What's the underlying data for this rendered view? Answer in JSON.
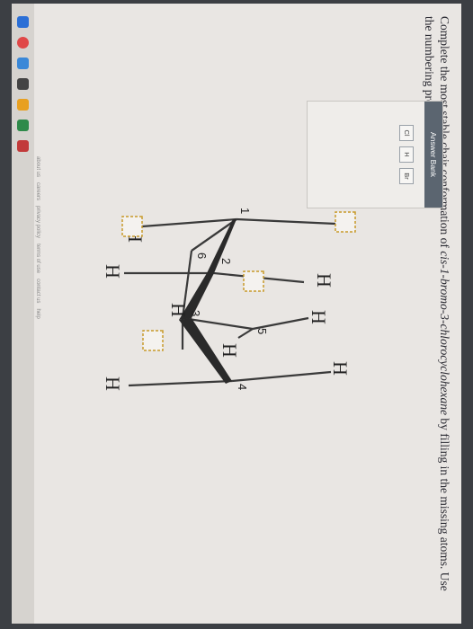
{
  "prompt": {
    "part1": "Complete the most stable chair conformation of ",
    "compound": "cis-1-bromo-3-chlorocyclohexane",
    "part2": " by filling in the missing atoms. Use the numbering provided on the ring."
  },
  "answer_bank": {
    "title": "Answer Bank",
    "items": [
      "Cl",
      "H",
      "Br"
    ]
  },
  "ring_numbers": [
    "1",
    "2",
    "3",
    "4",
    "5",
    "6"
  ],
  "atoms": {
    "h_c1_axial": "H",
    "h_c2_axial": "H",
    "h_c2_eq": "H",
    "h_c3": "H",
    "h_c4_axial": "H",
    "h_c4_eq": "H",
    "h_c5_eq": "H",
    "h_c6_axial": "H"
  },
  "footer": [
    "about us",
    "careers",
    "privacy policy",
    "terms of use",
    "contact us",
    "help"
  ],
  "colors": {
    "bond": "#3a3a3a",
    "wedge": "#2a2a2a",
    "dropbox": "#c89a2a"
  }
}
